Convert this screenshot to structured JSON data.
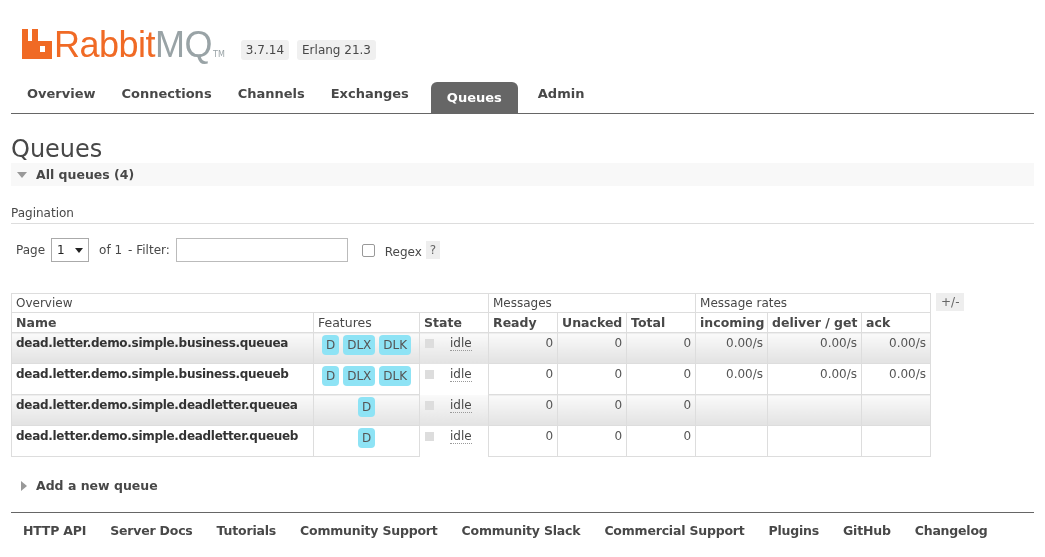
{
  "logo": {
    "part_1": "Rabbit",
    "part_2": "MQ",
    "trademark": "TM"
  },
  "versions": [
    "3.7.14",
    "Erlang 21.3"
  ],
  "tabs": [
    {
      "label": "Overview",
      "selected": false
    },
    {
      "label": "Connections",
      "selected": false
    },
    {
      "label": "Channels",
      "selected": false
    },
    {
      "label": "Exchanges",
      "selected": false
    },
    {
      "label": "Queues",
      "selected": true
    },
    {
      "label": "Admin",
      "selected": false
    }
  ],
  "page_title": "Queues",
  "section": {
    "label": "All queues (4)",
    "expanded": true
  },
  "pagination": {
    "heading": "Pagination",
    "page_label": "Page",
    "page_value": "1",
    "of_label": "of 1",
    "filter_label": "- Filter:",
    "regex": {
      "label": "Regex",
      "checked": false
    },
    "help": "?"
  },
  "table": {
    "groups": [
      {
        "label": "Overview"
      },
      {
        "label": "Messages"
      },
      {
        "label": "Message rates"
      }
    ],
    "columns": [
      "Name",
      "Features",
      "State",
      "Ready",
      "Unacked",
      "Total",
      "incoming",
      "deliver / get",
      "ack"
    ],
    "toggle": "+/-",
    "rows": [
      {
        "name": "dead.letter.demo.simple.business.queuea",
        "features": [
          "D",
          "DLX",
          "DLK"
        ],
        "state": "idle",
        "ready": "0",
        "unacked": "0",
        "total": "0",
        "incoming": "0.00/s",
        "deliver_get": "0.00/s",
        "ack": "0.00/s"
      },
      {
        "name": "dead.letter.demo.simple.business.queueb",
        "features": [
          "D",
          "DLX",
          "DLK"
        ],
        "state": "idle",
        "ready": "0",
        "unacked": "0",
        "total": "0",
        "incoming": "0.00/s",
        "deliver_get": "0.00/s",
        "ack": "0.00/s"
      },
      {
        "name": "dead.letter.demo.simple.deadletter.queuea",
        "features": [
          "D"
        ],
        "state": "idle",
        "ready": "0",
        "unacked": "0",
        "total": "0"
      },
      {
        "name": "dead.letter.demo.simple.deadletter.queueb",
        "features": [
          "D"
        ],
        "state": "idle",
        "ready": "0",
        "unacked": "0",
        "total": "0"
      }
    ]
  },
  "add_section": {
    "label": "Add a new queue",
    "expanded": false
  },
  "footer_links": [
    "HTTP API",
    "Server Docs",
    "Tutorials",
    "Community Support",
    "Community Slack",
    "Commercial Support",
    "Plugins",
    "GitHub",
    "Changelog"
  ]
}
